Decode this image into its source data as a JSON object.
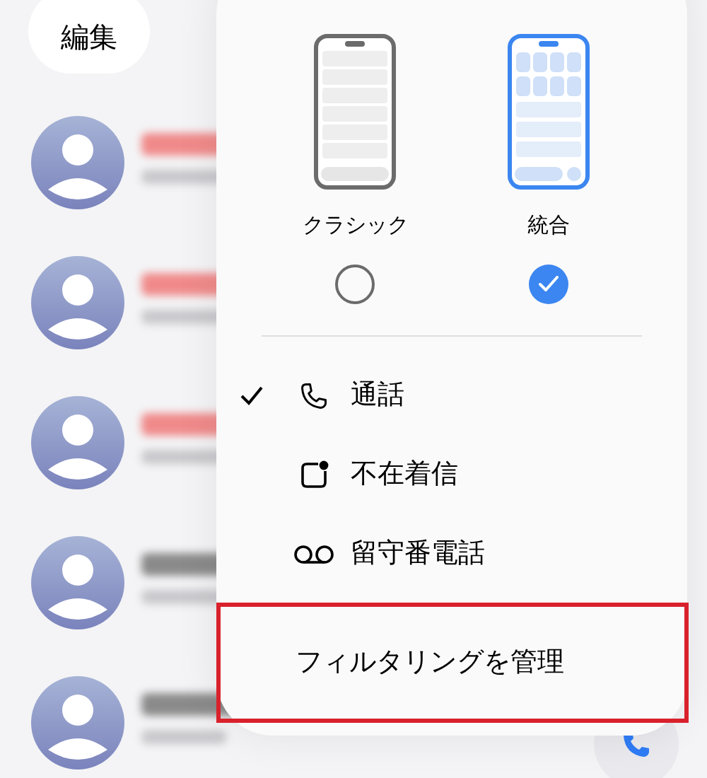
{
  "edit_button": "編集",
  "recents": [
    {
      "missed": true
    },
    {
      "missed": true
    },
    {
      "missed": true
    },
    {
      "missed": false
    },
    {
      "missed": false
    }
  ],
  "layouts": [
    {
      "kind": "classic",
      "label": "クラシック",
      "selected": false
    },
    {
      "kind": "unified",
      "label": "統合",
      "selected": true
    }
  ],
  "filters": [
    {
      "kind": "calls",
      "label": "通話",
      "checked": true
    },
    {
      "kind": "missed",
      "label": "不在着信",
      "checked": false
    },
    {
      "kind": "voicemail",
      "label": "留守番電話",
      "checked": false
    }
  ],
  "manage": {
    "label": "フィルタリングを管理",
    "highlighted": true
  }
}
